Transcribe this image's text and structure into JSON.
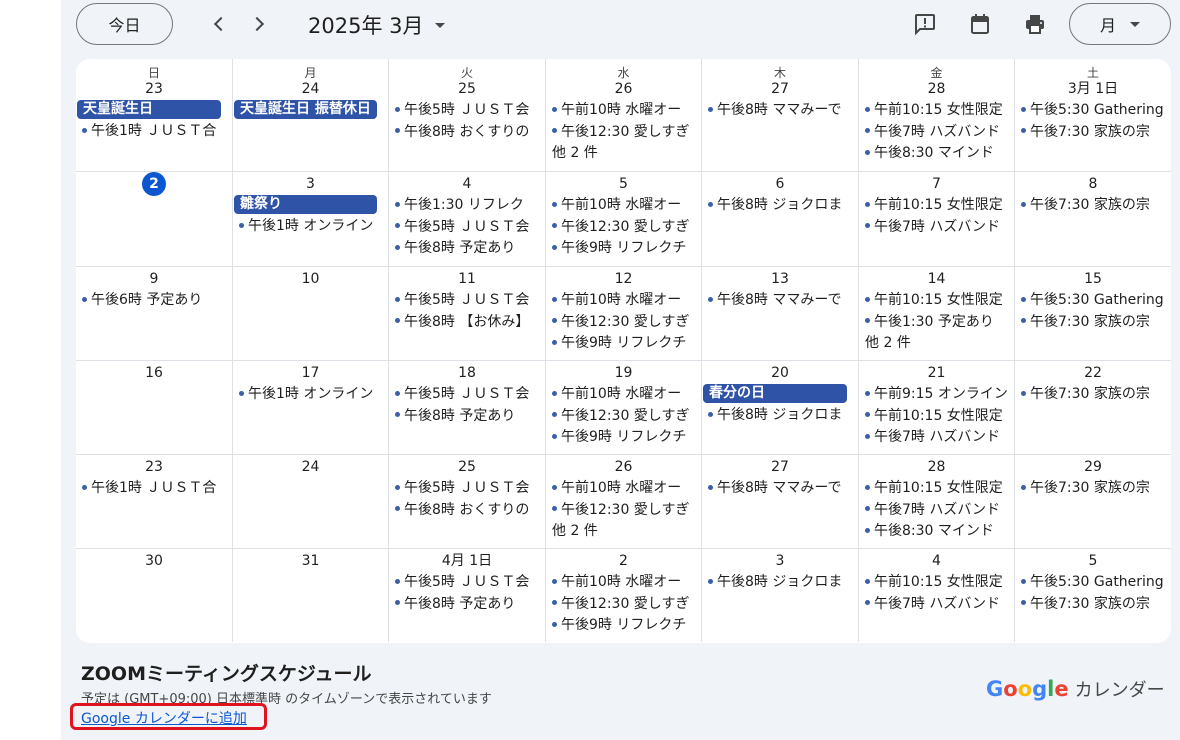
{
  "toolbar": {
    "today_label": "今日",
    "month_title": "2025年 3月",
    "view_label": "月"
  },
  "colors": {
    "today_circle": "#0b57d0",
    "allday_event": "#2f54a7",
    "event_dot": "#3b5fa8",
    "highlight_box": "#e0141e"
  },
  "weekdays": [
    "日",
    "月",
    "火",
    "水",
    "木",
    "金",
    "土"
  ],
  "weeks": [
    [
      {
        "date": "23",
        "allday": [
          "天皇誕生日"
        ],
        "events": [
          "午後1時 ＪＵＳＴ合"
        ]
      },
      {
        "date": "24",
        "allday": [
          "天皇誕生日 振替休日"
        ],
        "events": []
      },
      {
        "date": "25",
        "allday": [],
        "events": [
          "午後5時 ＪＵＳＴ会",
          "午後8時 おくすりの"
        ]
      },
      {
        "date": "26",
        "allday": [],
        "events": [
          "午前10時 水曜オー",
          "午後12:30 愛しすぎ"
        ],
        "more": "他 2 件"
      },
      {
        "date": "27",
        "allday": [],
        "events": [
          "午後8時 ママみーで"
        ]
      },
      {
        "date": "28",
        "allday": [],
        "events": [
          "午前10:15 女性限定",
          "午後7時 ハズバンド",
          "午後8:30 マインド"
        ]
      },
      {
        "date": "3月 1日",
        "allday": [],
        "events": [
          "午後5:30 Gathering",
          "午後7:30 家族の宗"
        ]
      }
    ],
    [
      {
        "date": "2",
        "today": true,
        "allday": [],
        "events": []
      },
      {
        "date": "3",
        "allday": [
          "雛祭り"
        ],
        "events": [
          "午後1時 オンライン"
        ]
      },
      {
        "date": "4",
        "allday": [],
        "events": [
          "午後1:30 リフレク",
          "午後5時 ＪＵＳＴ会",
          "午後8時 予定あり"
        ]
      },
      {
        "date": "5",
        "allday": [],
        "events": [
          "午前10時 水曜オー",
          "午後12:30 愛しすぎ",
          "午後9時 リフレクチ"
        ]
      },
      {
        "date": "6",
        "allday": [],
        "events": [
          "午後8時 ジョクロま"
        ]
      },
      {
        "date": "7",
        "allday": [],
        "events": [
          "午前10:15 女性限定",
          "午後7時 ハズバンド"
        ]
      },
      {
        "date": "8",
        "allday": [],
        "events": [
          "午後7:30 家族の宗"
        ]
      }
    ],
    [
      {
        "date": "9",
        "allday": [],
        "events": [
          "午後6時 予定あり"
        ]
      },
      {
        "date": "10",
        "allday": [],
        "events": []
      },
      {
        "date": "11",
        "allday": [],
        "events": [
          "午後5時 ＪＵＳＴ会",
          "午後8時 【お休み】"
        ]
      },
      {
        "date": "12",
        "allday": [],
        "events": [
          "午前10時 水曜オー",
          "午後12:30 愛しすぎ",
          "午後9時 リフレクチ"
        ]
      },
      {
        "date": "13",
        "allday": [],
        "events": [
          "午後8時 ママみーで"
        ]
      },
      {
        "date": "14",
        "allday": [],
        "events": [
          "午前10:15 女性限定",
          "午後1:30 予定あり"
        ],
        "more": "他 2 件"
      },
      {
        "date": "15",
        "allday": [],
        "events": [
          "午後5:30 Gathering",
          "午後7:30 家族の宗"
        ]
      }
    ],
    [
      {
        "date": "16",
        "allday": [],
        "events": []
      },
      {
        "date": "17",
        "allday": [],
        "events": [
          "午後1時 オンライン"
        ]
      },
      {
        "date": "18",
        "allday": [],
        "events": [
          "午後5時 ＪＵＳＴ会",
          "午後8時 予定あり"
        ]
      },
      {
        "date": "19",
        "allday": [],
        "events": [
          "午前10時 水曜オー",
          "午後12:30 愛しすぎ",
          "午後9時 リフレクチ"
        ]
      },
      {
        "date": "20",
        "allday": [
          "春分の日"
        ],
        "events": [
          "午後8時 ジョクロま"
        ]
      },
      {
        "date": "21",
        "allday": [],
        "events": [
          "午前9:15 オンライン",
          "午前10:15 女性限定",
          "午後7時 ハズバンド"
        ]
      },
      {
        "date": "22",
        "allday": [],
        "events": [
          "午後7:30 家族の宗"
        ]
      }
    ],
    [
      {
        "date": "23",
        "allday": [],
        "events": [
          "午後1時 ＪＵＳＴ合"
        ]
      },
      {
        "date": "24",
        "allday": [],
        "events": []
      },
      {
        "date": "25",
        "allday": [],
        "events": [
          "午後5時 ＪＵＳＴ会",
          "午後8時 おくすりの"
        ]
      },
      {
        "date": "26",
        "allday": [],
        "events": [
          "午前10時 水曜オー",
          "午後12:30 愛しすぎ"
        ],
        "more": "他 2 件"
      },
      {
        "date": "27",
        "allday": [],
        "events": [
          "午後8時 ママみーで"
        ]
      },
      {
        "date": "28",
        "allday": [],
        "events": [
          "午前10:15 女性限定",
          "午後7時 ハズバンド",
          "午後8:30 マインド"
        ]
      },
      {
        "date": "29",
        "allday": [],
        "events": [
          "午後7:30 家族の宗"
        ]
      }
    ],
    [
      {
        "date": "30",
        "allday": [],
        "events": []
      },
      {
        "date": "31",
        "allday": [],
        "events": []
      },
      {
        "date": "4月 1日",
        "allday": [],
        "events": [
          "午後5時 ＪＵＳＴ会",
          "午後8時 予定あり"
        ]
      },
      {
        "date": "2",
        "allday": [],
        "events": [
          "午前10時 水曜オー",
          "午後12:30 愛しすぎ",
          "午後9時 リフレクチ"
        ]
      },
      {
        "date": "3",
        "allday": [],
        "events": [
          "午後8時 ジョクロま"
        ]
      },
      {
        "date": "4",
        "allday": [],
        "events": [
          "午前10:15 女性限定",
          "午後7時 ハズバンド"
        ]
      },
      {
        "date": "5",
        "allday": [],
        "events": [
          "午後5:30 Gathering",
          "午後7:30 家族の宗"
        ]
      }
    ]
  ],
  "footer": {
    "calendar_name": "ZOOMミーティングスケジュール",
    "timezone_note": "予定は (GMT+09:00) 日本標準時 のタイムゾーンで表示されています",
    "add_link": "Google カレンダーに追加",
    "brand_google": "Google",
    "brand_calendar": "カレンダー"
  }
}
